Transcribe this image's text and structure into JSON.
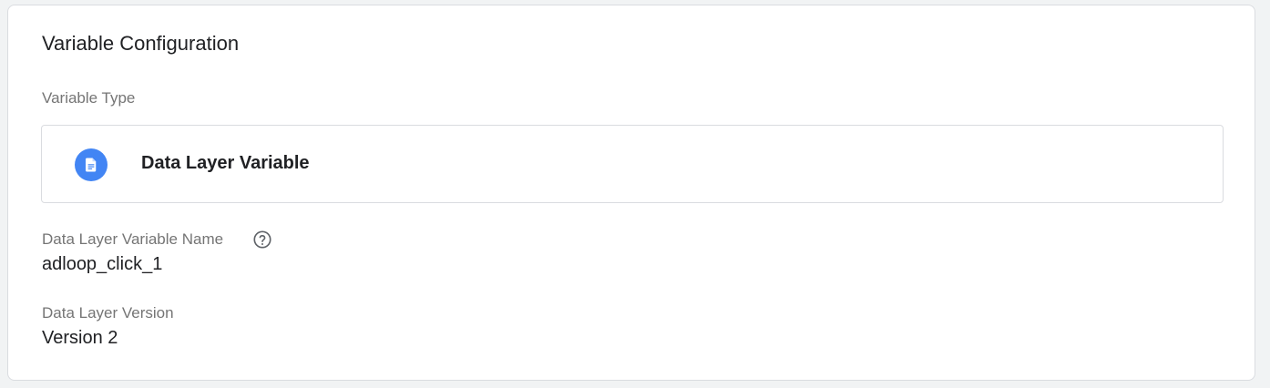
{
  "card": {
    "title": "Variable Configuration"
  },
  "variable_type": {
    "label": "Variable Type",
    "name": "Data Layer Variable",
    "icon": "document-icon",
    "icon_color": "#4285f4"
  },
  "variable_name": {
    "label": "Data Layer Variable Name",
    "value": "adloop_click_1",
    "help_icon": "help-icon"
  },
  "version": {
    "label": "Data Layer Version",
    "value": "Version 2"
  }
}
